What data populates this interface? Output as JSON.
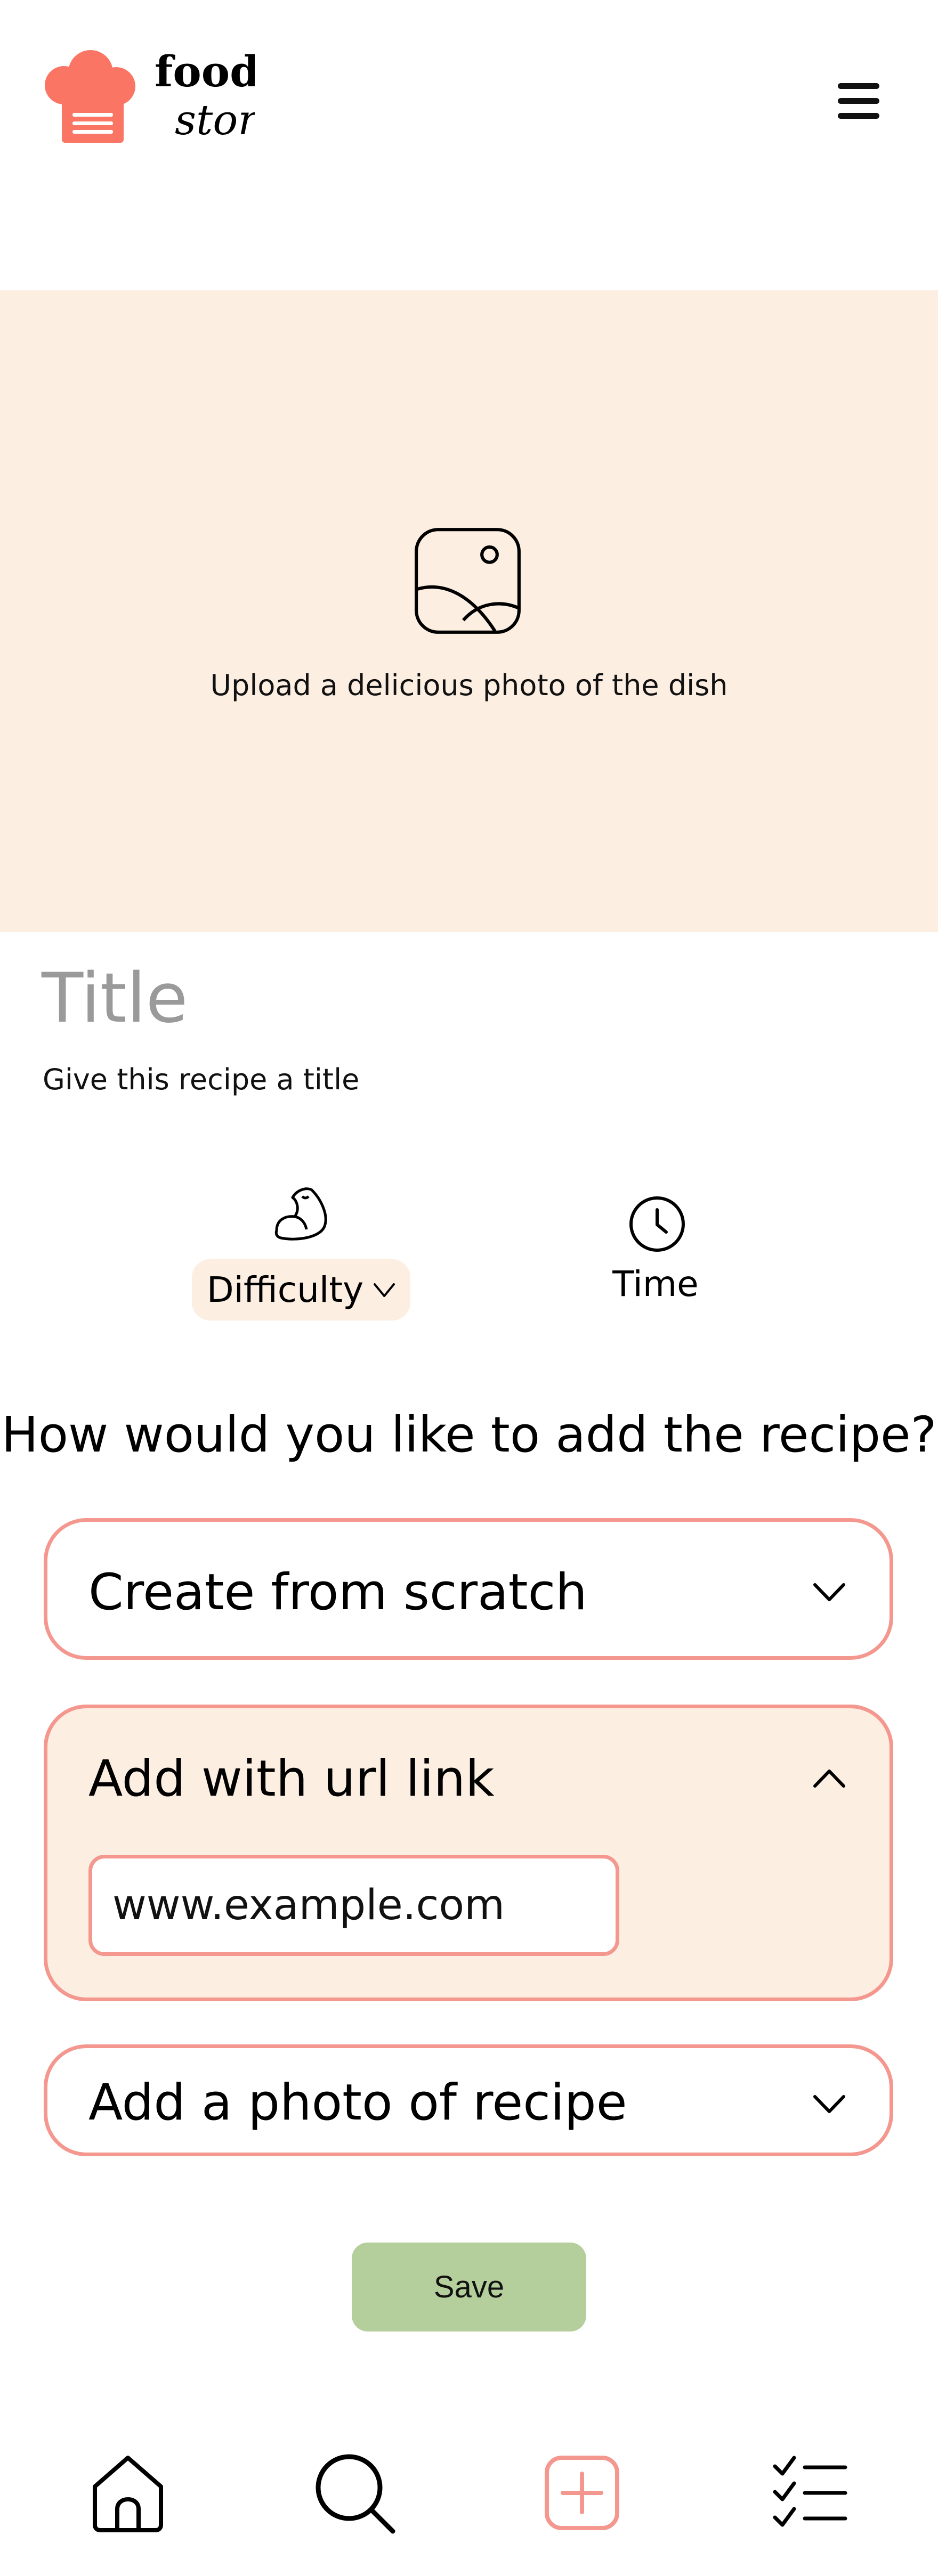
{
  "brand": {
    "name_line1": "food",
    "name_line2": "story",
    "logo_color": "#FA7564"
  },
  "upload": {
    "text": "Upload a delicious photo of the dish",
    "background": "#FDEEE2"
  },
  "recipe": {
    "title_placeholder": "Title",
    "title_hint": "Give this recipe a title"
  },
  "meta": {
    "difficulty_label": "Difficulty",
    "time_label": "Time"
  },
  "add_method": {
    "question": "How would you like to add the recipe?",
    "options": [
      {
        "label": "Create from scratch",
        "expanded": false
      },
      {
        "label": "Add with url link",
        "expanded": true,
        "input_value": "www.example.com"
      },
      {
        "label": "Add a photo of recipe",
        "expanded": false
      }
    ]
  },
  "actions": {
    "save_label": "Save",
    "save_color": "#B4CF9B"
  },
  "bottom_nav": {
    "items": [
      {
        "icon": "home-icon",
        "active": false
      },
      {
        "icon": "search-icon",
        "active": false
      },
      {
        "icon": "add-icon",
        "active": true
      },
      {
        "icon": "checklist-icon",
        "active": false
      }
    ],
    "accent": "#F4978E"
  }
}
